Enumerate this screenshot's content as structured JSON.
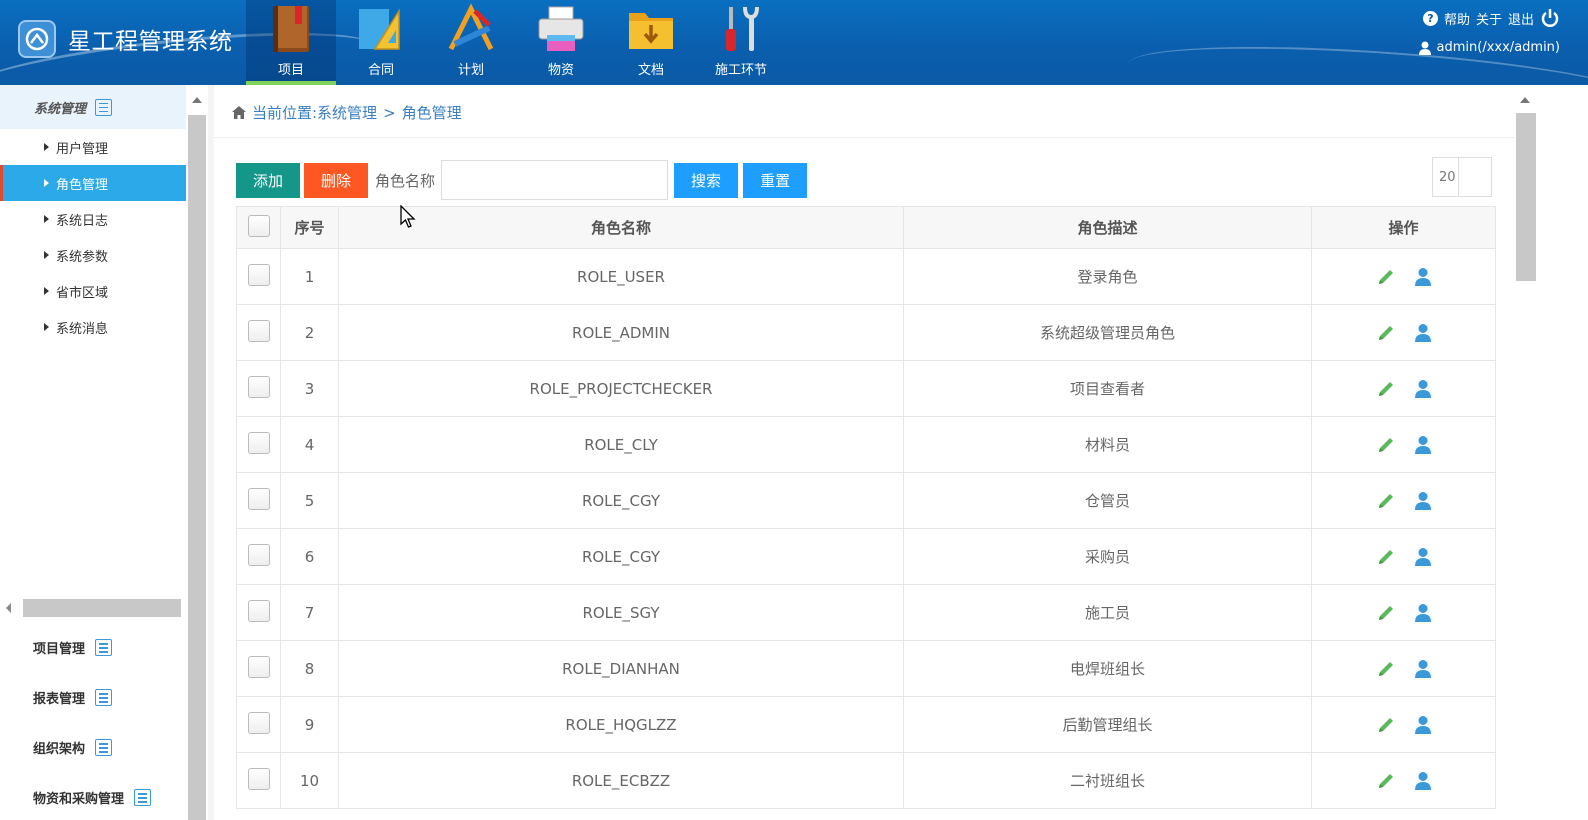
{
  "app": {
    "title": "星工程管理系统"
  },
  "topnav": [
    {
      "label": "项目",
      "icon": "book-icon",
      "active": true
    },
    {
      "label": "合同",
      "icon": "set-square-icon",
      "active": false
    },
    {
      "label": "计划",
      "icon": "drafting-tools-icon",
      "active": false
    },
    {
      "label": "物资",
      "icon": "printer-icon",
      "active": false
    },
    {
      "label": "文档",
      "icon": "folder-icon",
      "active": false
    },
    {
      "label": "施工环节",
      "icon": "tools-icon",
      "active": false
    }
  ],
  "top_right": {
    "help": "帮助",
    "about": "关于",
    "logout": "退出",
    "user": "admin(/xxx/admin)"
  },
  "sidebar": {
    "section_title": "系统管理",
    "items": [
      {
        "label": "用户管理"
      },
      {
        "label": "角色管理",
        "active": true
      },
      {
        "label": "系统日志"
      },
      {
        "label": "系统参数"
      },
      {
        "label": "省市区域"
      },
      {
        "label": "系统消息"
      }
    ],
    "groups": [
      {
        "label": "项目管理"
      },
      {
        "label": "报表管理"
      },
      {
        "label": "组织架构"
      },
      {
        "label": "物资和采购管理"
      }
    ]
  },
  "breadcrumb": {
    "text": "当前位置:系统管理",
    "sep": ">",
    "current": "角色管理"
  },
  "toolbar": {
    "add_label": "添加",
    "delete_label": "删除",
    "search_label": "角色名称",
    "search_value": "",
    "search_button": "搜索",
    "reset_button": "重置",
    "page_size": "20"
  },
  "table": {
    "headers": {
      "index": "序号",
      "name": "角色名称",
      "desc": "角色描述",
      "ops": "操作"
    },
    "rows": [
      {
        "index": "1",
        "name": "ROLE_USER",
        "desc": "登录角色"
      },
      {
        "index": "2",
        "name": "ROLE_ADMIN",
        "desc": "系统超级管理员角色"
      },
      {
        "index": "3",
        "name": "ROLE_PROJECTCHECKER",
        "desc": "项目查看者"
      },
      {
        "index": "4",
        "name": "ROLE_CLY",
        "desc": "材料员"
      },
      {
        "index": "5",
        "name": "ROLE_CGY",
        "desc": "仓管员"
      },
      {
        "index": "6",
        "name": "ROLE_CGY",
        "desc": "采购员"
      },
      {
        "index": "7",
        "name": "ROLE_SGY",
        "desc": "施工员"
      },
      {
        "index": "8",
        "name": "ROLE_DIANHAN",
        "desc": "电焊班组长"
      },
      {
        "index": "9",
        "name": "ROLE_HQGLZZ",
        "desc": "后勤管理组长"
      },
      {
        "index": "10",
        "name": "ROLE_ECBZZ",
        "desc": "二衬班组长"
      }
    ]
  },
  "colors": {
    "header_bg": "#0b5aa5",
    "sidebar_active": "#2ba9e8",
    "add": "#149688",
    "delete": "#ff5722",
    "primary": "#1e9fff",
    "edit_icon": "#5cb85c",
    "user_icon": "#3b98d9"
  }
}
